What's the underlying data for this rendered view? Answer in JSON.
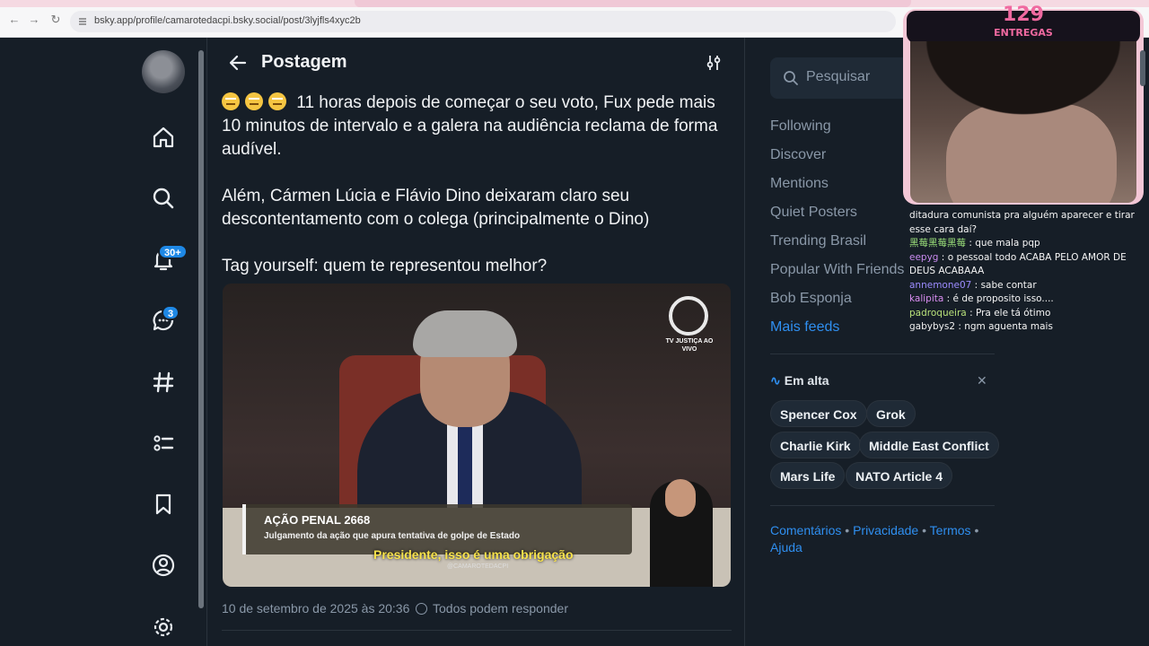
{
  "browser": {
    "url": "bsky.app/profile/camarotedacpi.bsky.social/post/3lyjfls4xyc2b"
  },
  "nav": {
    "notifications_badge": "30+",
    "chat_badge": "3"
  },
  "header": {
    "title": "Postagem"
  },
  "post": {
    "text_1": "11 horas depois de começar o seu voto, Fux pede mais 10 minutos de intervalo e a galera na audiência reclama de forma audível.",
    "text_2": "Além, Cármen Lúcia e Flávio Dino deixaram claro seu descontentamento com o colega (principalmente o Dino)",
    "text_3": "Tag yourself: quem te representou melhor?",
    "timestamp": "10 de setembro de 2025 às 20:36",
    "reply_setting": "Todos podem responder",
    "video": {
      "channel_logo_text": "TV JUSTIÇA AO VIVO",
      "lower_third_title": "AÇÃO PENAL 2668",
      "lower_third_sub": "Julgamento da ação que apura tentativa de golpe de Estado",
      "caption": "Presidente, isso é uma obrigação",
      "watermark": "@CAMAROTEDACPI"
    }
  },
  "right": {
    "search_placeholder": "Pesquisar",
    "feeds": [
      "Following",
      "Discover",
      "Mentions",
      "Quiet Posters",
      "Trending Brasil",
      "Popular With Friends",
      "Bob Esponja"
    ],
    "more_feeds": "Mais feeds",
    "trending_title": "Em alta",
    "trending": [
      "Spencer Cox",
      "Grok",
      "Charlie Kirk",
      "Middle East Conflict",
      "Mars Life",
      "NATO Article 4"
    ],
    "footer": [
      "Comentários",
      "Privacidade",
      "Termos",
      "Ajuda"
    ]
  },
  "stream": {
    "count": "129",
    "label": "ENTREGAS",
    "chat": [
      {
        "user": "",
        "msg": "ditadura comunista pra alguém aparecer e tirar esse cara daí?"
      },
      {
        "user": "黑莓黑莓黑莓",
        "msg": "que mala pqp"
      },
      {
        "user": "eepyg",
        "msg": "o pessoal todo ACABA PELO AMOR DE DEUS ACABAAA"
      },
      {
        "user": "annemone07",
        "msg": "sabe contar"
      },
      {
        "user": "kalipita",
        "msg": "é de proposito isso...."
      },
      {
        "user": "padroqueira",
        "msg": "Pra ele tá ótimo"
      },
      {
        "user": "gabybys2",
        "msg": "ngm aguenta mais"
      }
    ]
  },
  "colors": {
    "background": "#161e27",
    "accent": "#2f8ff0",
    "muted": "#8a98a8"
  }
}
